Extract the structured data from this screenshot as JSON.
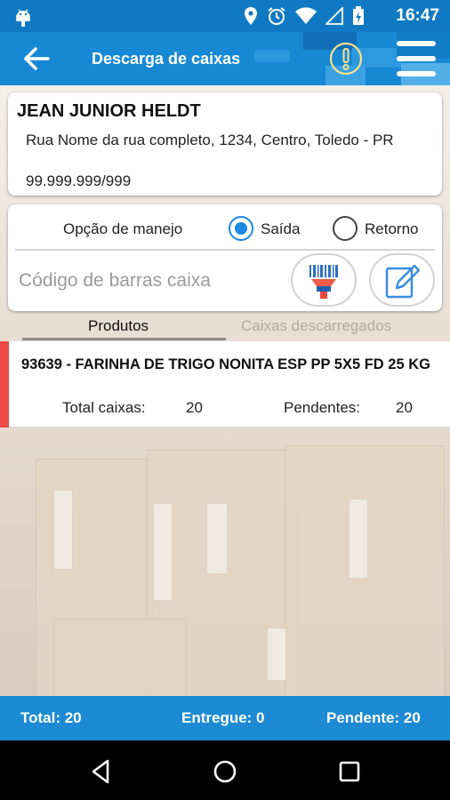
{
  "status_bar": {
    "time": "16:47",
    "icons": [
      "android-icon",
      "location-icon",
      "alarm-icon",
      "wifi-icon",
      "signal-icon",
      "battery-icon"
    ]
  },
  "app_bar": {
    "title": "Descarga de caixas",
    "back_icon": "back-arrow-icon",
    "alert_icon": "alert-icon",
    "menu_icon": "menu-icon",
    "color": "#1788d3"
  },
  "client": {
    "name": "JEAN JUNIOR HELDT",
    "address": "Rua Nome da rua completo, 1234, Centro, Toledo - PR",
    "document": "99.999.999/999"
  },
  "handling": {
    "label": "Opção de manejo",
    "options": [
      {
        "label": "Saída",
        "selected": true
      },
      {
        "label": "Retorno",
        "selected": false
      }
    ],
    "barcode_placeholder": "Código de barras caixa",
    "barcode_value": "",
    "scan_icon": "barcode-scanner-icon",
    "edit_icon": "edit-icon"
  },
  "tabs": [
    {
      "label": "Produtos",
      "active": true
    },
    {
      "label": "Caixas descarregados",
      "active": false
    }
  ],
  "products": [
    {
      "description": "93639 - FARINHA DE TRIGO NONITA ESP PP 5X5 FD 25 KG",
      "total_label": "Total caixas:",
      "total_value": "20",
      "pending_label": "Pendentes:",
      "pending_value": "20",
      "status_color": "#ef4b45"
    }
  ],
  "summary": {
    "total": "Total: 20",
    "delivered": "Entregue: 0",
    "pending": "Pendente: 20"
  },
  "nav_bar": {
    "icons": [
      "nav-back-icon",
      "nav-home-icon",
      "nav-recents-icon"
    ]
  }
}
